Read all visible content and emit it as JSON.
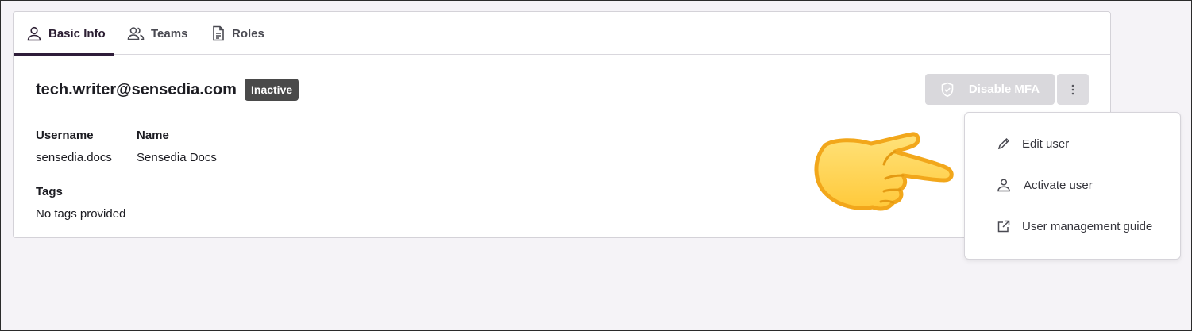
{
  "tabs": [
    {
      "label": "Basic Info",
      "icon": "user-icon",
      "active": true
    },
    {
      "label": "Teams",
      "icon": "users-icon",
      "active": false
    },
    {
      "label": "Roles",
      "icon": "document-icon",
      "active": false
    }
  ],
  "user": {
    "email": "tech.writer@sensedia.com",
    "status": "Inactive"
  },
  "actions": {
    "disable_mfa_label": "Disable MFA",
    "more_icon": "more-vertical-icon"
  },
  "fields": {
    "username_label": "Username",
    "username_value": "sensedia.docs",
    "name_label": "Name",
    "name_value": "Sensedia Docs",
    "tags_label": "Tags",
    "tags_value": "No tags provided"
  },
  "menu": {
    "items": [
      {
        "label": "Edit user",
        "icon": "pencil-icon"
      },
      {
        "label": "Activate user",
        "icon": "user-icon"
      },
      {
        "label": "User management guide",
        "icon": "external-link-icon"
      }
    ]
  },
  "colors": {
    "accent": "#2f1d3a",
    "badge_bg": "#4a4a4a",
    "button_disabled": "#d9d8dc"
  }
}
